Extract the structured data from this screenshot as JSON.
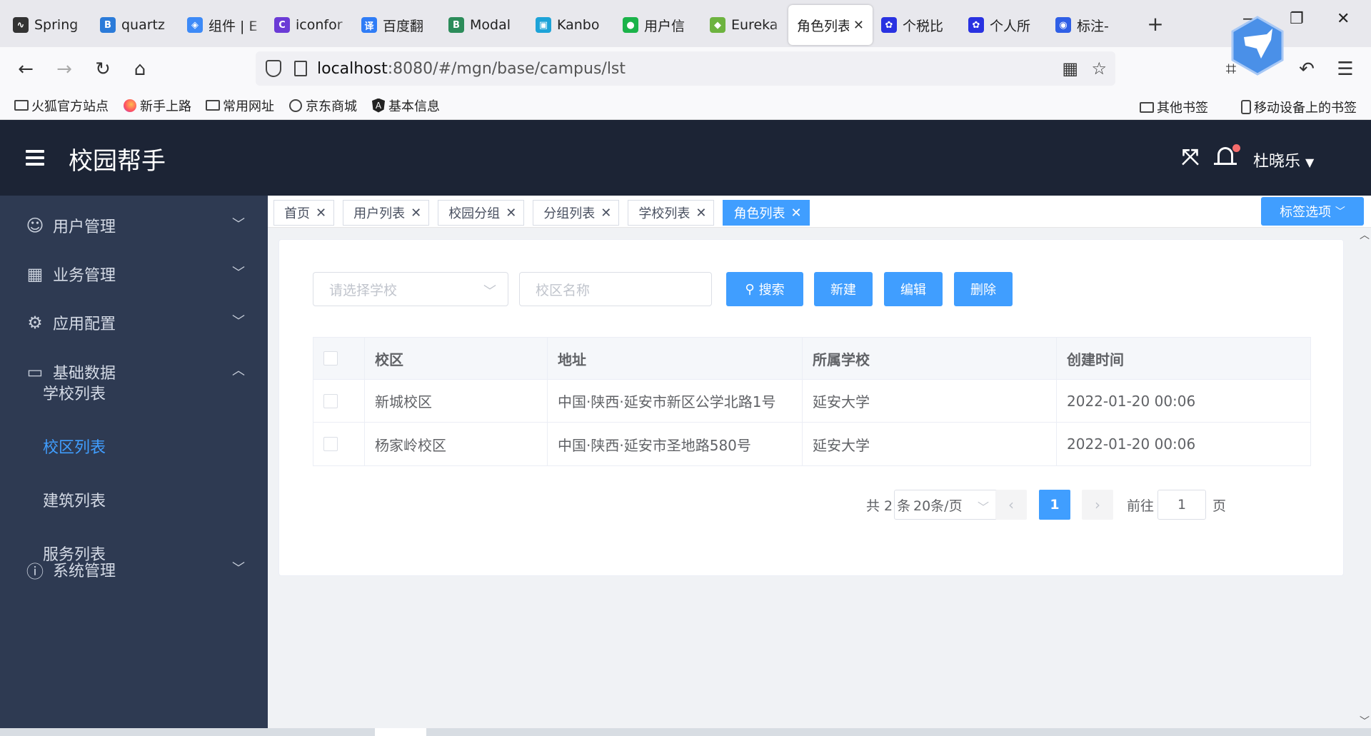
{
  "browser": {
    "tabs": [
      {
        "label": "Spring",
        "color": "#333333",
        "glyph": "∿"
      },
      {
        "label": "quartz",
        "color": "#2b7bd9",
        "glyph": "B"
      },
      {
        "label": "组件 | E",
        "color": "#3d8af7",
        "glyph": "◈"
      },
      {
        "label": "iconfor",
        "color": "#6b3bd6",
        "glyph": "C"
      },
      {
        "label": "百度翻",
        "color": "#2f7cf6",
        "glyph": "译"
      },
      {
        "label": "Modal",
        "color": "#2c8c5a",
        "glyph": "B"
      },
      {
        "label": "Kanbo",
        "color": "#1da3d8",
        "glyph": "▣"
      },
      {
        "label": "用户信",
        "color": "#1bb34a",
        "glyph": "●"
      },
      {
        "label": "Eureka",
        "color": "#6db33f",
        "glyph": "◆"
      },
      {
        "label": "角色列表",
        "color": "#ffffff",
        "glyph": "",
        "active": true
      },
      {
        "label": "个税比",
        "color": "#2932e1",
        "glyph": "✿"
      },
      {
        "label": "个人所",
        "color": "#2932e1",
        "glyph": "✿"
      },
      {
        "label": "标注-",
        "color": "#2f5fe6",
        "glyph": "◉"
      }
    ],
    "new_tab": "+",
    "url_host": "localhost",
    "url_rest": ":8080/#/mgn/base/campus/lst",
    "bookmarks": [
      {
        "label": "火狐官方站点",
        "icon": "folder-icon"
      },
      {
        "label": "新手上路",
        "icon": "firefox-icon"
      },
      {
        "label": "常用网址",
        "icon": "folder-icon"
      },
      {
        "label": "京东商城",
        "icon": "globe-icon"
      },
      {
        "label": "基本信息",
        "icon": "angular-icon"
      }
    ],
    "other_bookmarks": "其他书签",
    "mobile_bookmarks": "移动设备上的书签"
  },
  "app": {
    "title": "校园帮手",
    "user": "杜晓乐"
  },
  "sidebar": {
    "groups": [
      {
        "label": "用户管理",
        "icon": "user-icon",
        "expanded": false
      },
      {
        "label": "业务管理",
        "icon": "grid-icon",
        "expanded": false
      },
      {
        "label": "应用配置",
        "icon": "gear-icon",
        "expanded": false
      },
      {
        "label": "基础数据",
        "icon": "monitor-icon",
        "expanded": true
      },
      {
        "label": "系统管理",
        "icon": "info-icon",
        "expanded": false
      }
    ],
    "subitems": [
      {
        "label": "学校列表",
        "active": false
      },
      {
        "label": "校区列表",
        "active": true
      },
      {
        "label": "建筑列表",
        "active": false
      },
      {
        "label": "服务列表",
        "active": false
      }
    ]
  },
  "tagsview": {
    "tags": [
      {
        "label": "首页",
        "active": false
      },
      {
        "label": "用户列表",
        "active": false
      },
      {
        "label": "校园分组",
        "active": false
      },
      {
        "label": "分组列表",
        "active": false
      },
      {
        "label": "学校列表",
        "active": false
      },
      {
        "label": "角色列表",
        "active": true
      }
    ],
    "options_label": "标签选项"
  },
  "filters": {
    "school_placeholder": "请选择学校",
    "campus_placeholder": "校区名称",
    "search_label": "搜索",
    "new_label": "新建",
    "edit_label": "编辑",
    "delete_label": "删除"
  },
  "table": {
    "columns": [
      "校区",
      "地址",
      "所属学校",
      "创建时间"
    ],
    "rows": [
      [
        "新城校区",
        "中国·陕西·延安市新区公学北路1号",
        "延安大学",
        "2022-01-20 00:06"
      ],
      [
        "杨家岭校区",
        "中国·陕西·延安市圣地路580号",
        "延安大学",
        "2022-01-20 00:06"
      ]
    ]
  },
  "pagination": {
    "total": "共 2 条",
    "page_size": "20条/页",
    "current": "1",
    "goto_prefix": "前往",
    "goto_value": "1",
    "goto_suffix": "页"
  },
  "colors": {
    "primary": "#409eff",
    "header_bg": "#1c2435",
    "sidebar_bg": "#2e3a52"
  }
}
